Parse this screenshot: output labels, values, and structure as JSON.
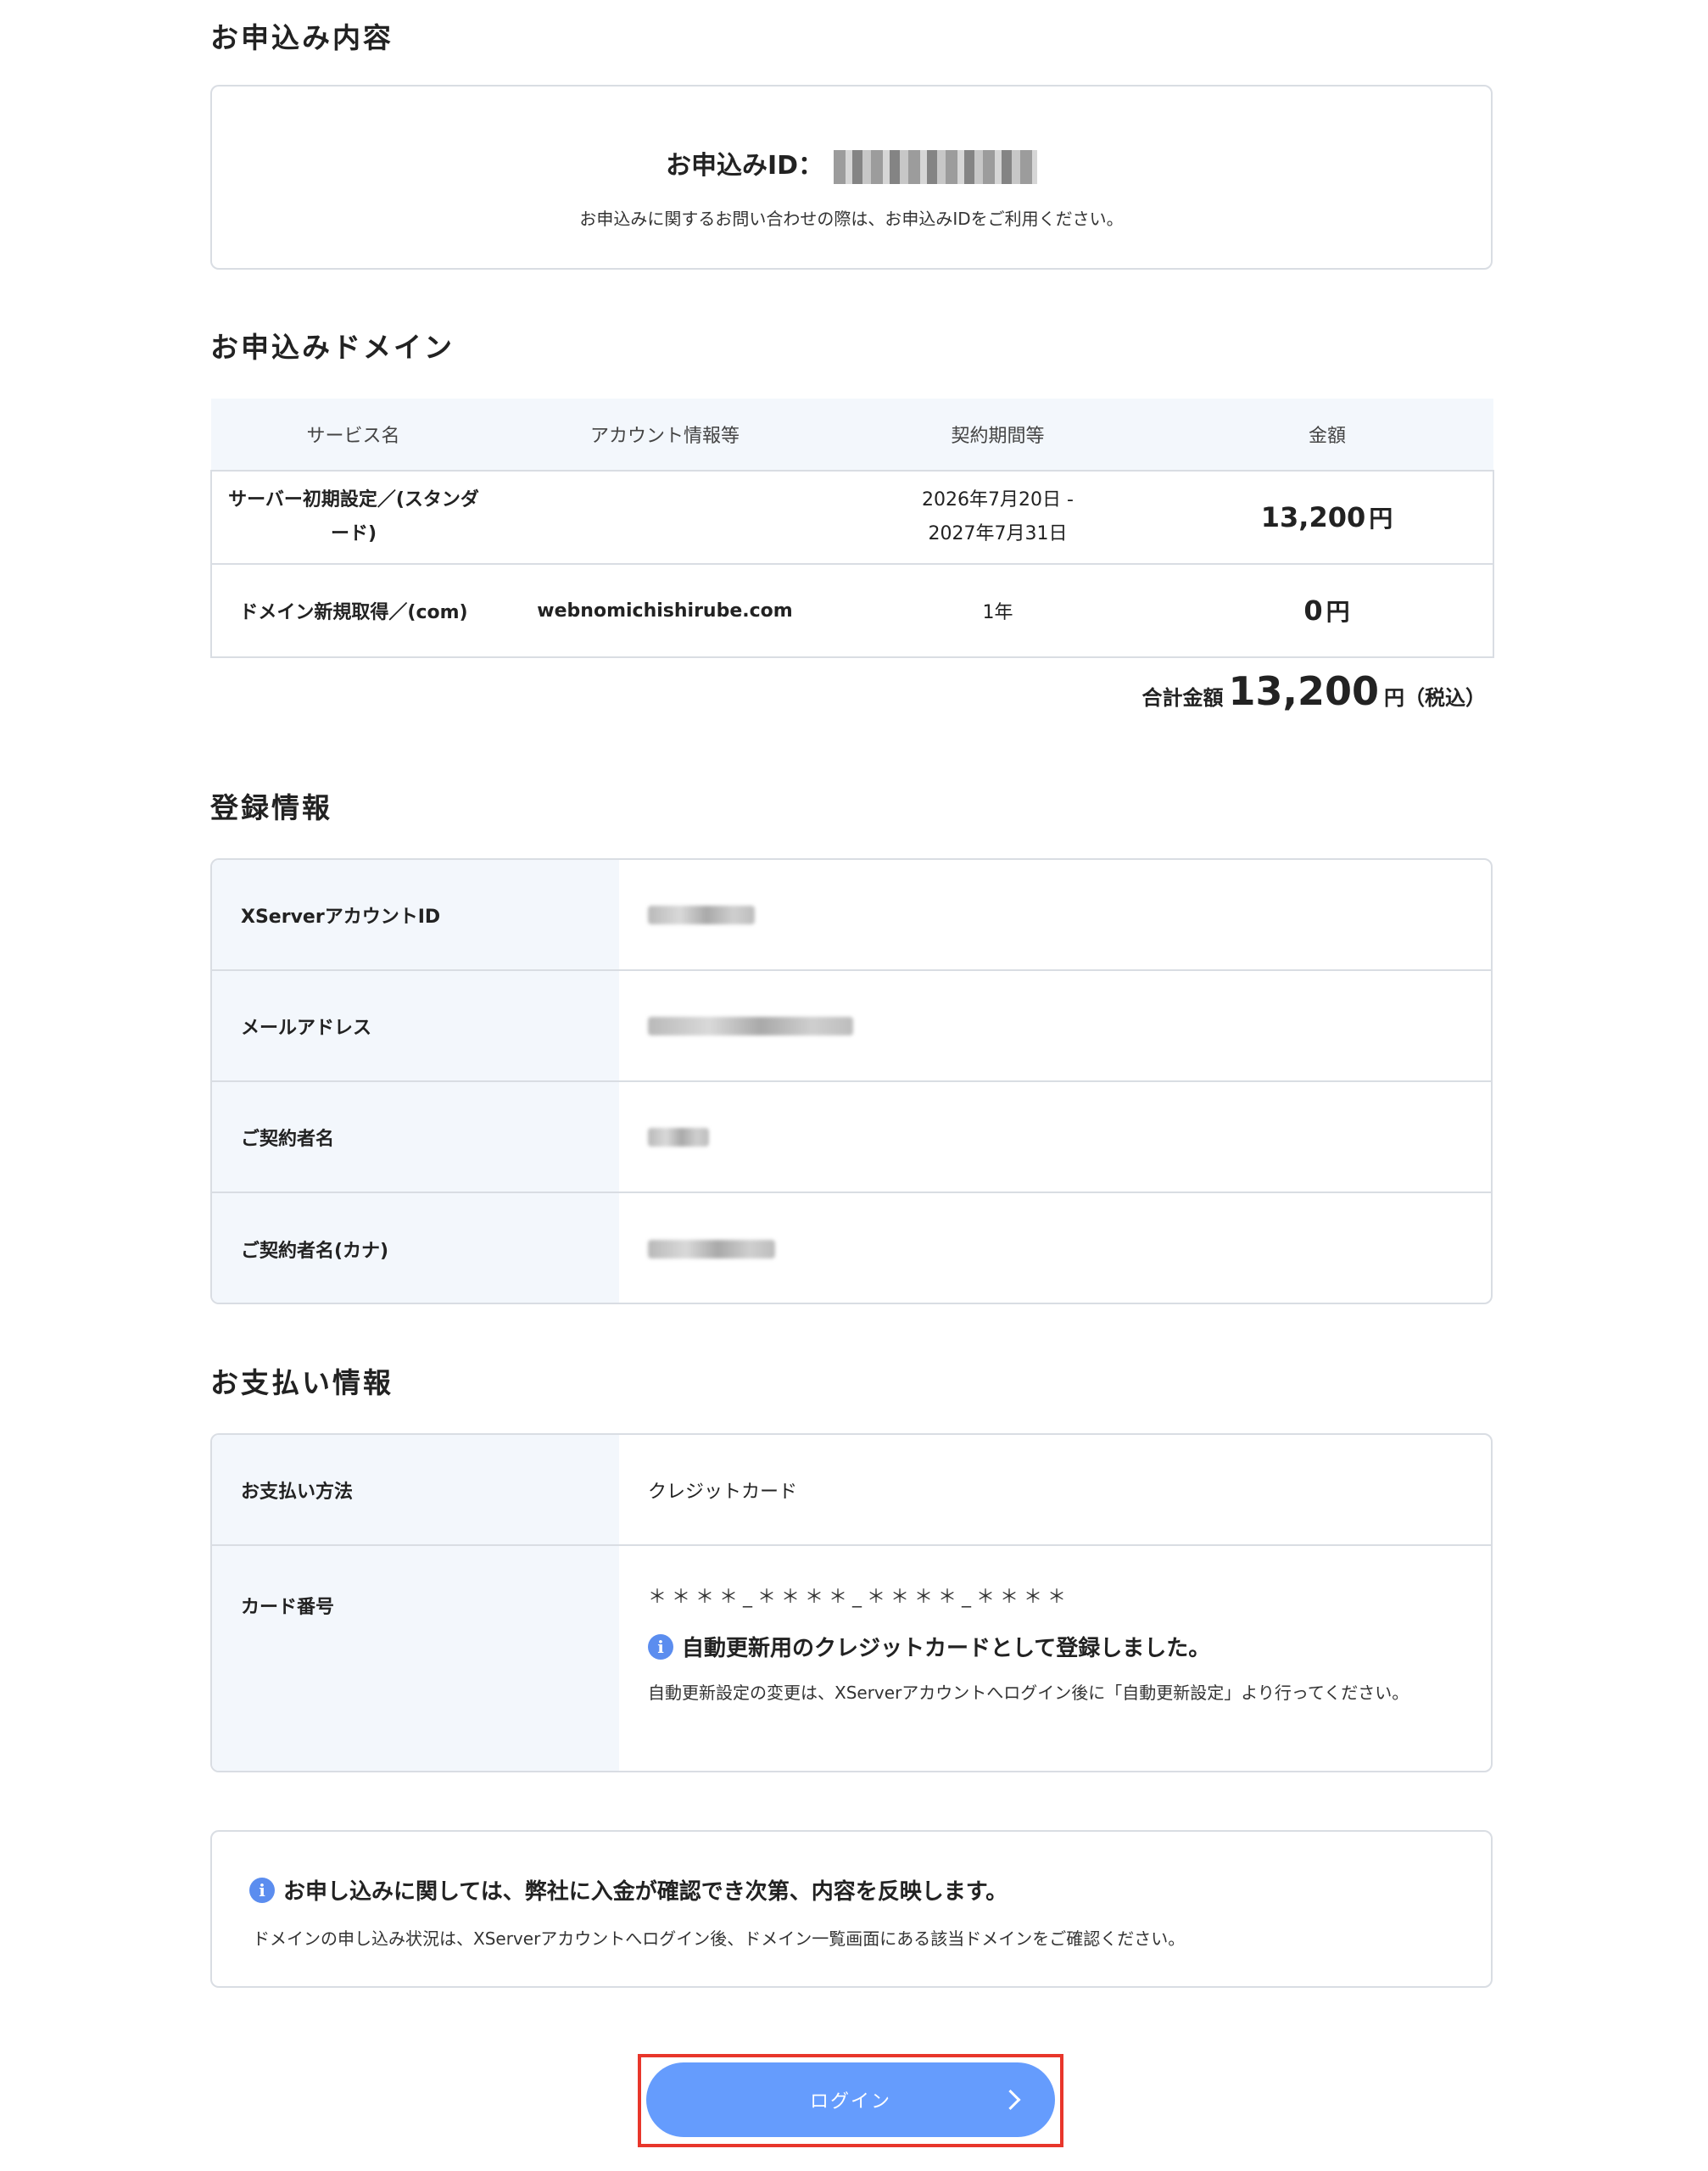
{
  "sections": {
    "application_title": "お申込み内容",
    "domain_title": "お申込みドメイン",
    "registration_title": "登録情報",
    "payment_title": "お支払い情報"
  },
  "application": {
    "id_label": "お申込みID：",
    "id_value": "",
    "note": "お申込みに関するお問い合わせの際は、お申込みIDをご利用ください。"
  },
  "domain_table": {
    "headers": [
      "サービス名",
      "アカウント情報等",
      "契約期間等",
      "金額"
    ],
    "rows": [
      {
        "service": "サーバー初期設定／(スタンダード)",
        "account": "",
        "period_line1": "2026年7月20日 -",
        "period_line2": "2027年7月31日",
        "amount": "13,200",
        "unit": "円"
      },
      {
        "service": "ドメイン新規取得／(com)",
        "account": "webnomichishirube.com",
        "period_line1": "1年",
        "period_line2": "",
        "amount": "0",
        "unit": "円"
      }
    ],
    "total_label": "合計金額",
    "total_value": "13,200",
    "total_unit": "円（税込）"
  },
  "registration": {
    "rows": [
      {
        "key": "XServerアカウントID",
        "value": ""
      },
      {
        "key": "メールアドレス",
        "value": ""
      },
      {
        "key": "ご契約者名",
        "value": ""
      },
      {
        "key": "ご契約者名(カナ)",
        "value": ""
      }
    ]
  },
  "payment": {
    "method_key": "お支払い方法",
    "method_value": "クレジットカード",
    "card_key": "カード番号",
    "card_value": "＊＊＊＊_＊＊＊＊_＊＊＊＊_＊＊＊＊",
    "info_title": "自動更新用のクレジットカードとして登録しました。",
    "info_text": "自動更新設定の変更は、XServerアカウントへログイン後に「自動更新設定」より行ってください。"
  },
  "notice": {
    "title": "お申し込みに関しては、弊社に入金が確認でき次第、内容を反映します。",
    "text": "ドメインの申し込み状況は、XServerアカウントへログイン後、ドメイン一覧画面にある該当ドメインをご確認ください。"
  },
  "login_button": {
    "label": "ログイン"
  },
  "colors": {
    "accent": "#659cfd",
    "highlight": "#e8362b",
    "header_bg": "#f3f7fc",
    "info_icon": "#5b8def"
  }
}
